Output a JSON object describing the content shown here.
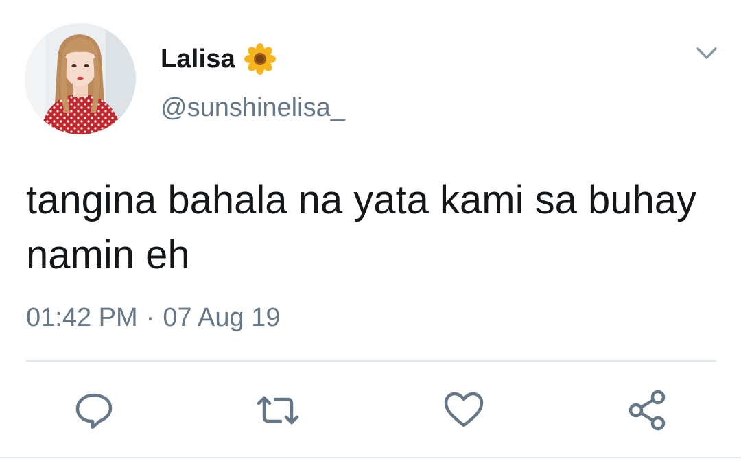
{
  "tweet": {
    "display_name": "Lalisa",
    "name_emoji": "sunflower-icon",
    "handle": "@sunshinelisa_",
    "text": "tangina bahala na yata kami sa buhay namin eh",
    "time": "01:42 PM",
    "separator": "·",
    "date": "07 Aug 19"
  },
  "icons": {
    "menu": "chevron-down-icon",
    "reply": "reply-icon",
    "retweet": "retweet-icon",
    "like": "heart-icon",
    "share": "share-icon"
  },
  "colors": {
    "text": "#14171a",
    "secondary": "#657786",
    "divider": "#e1e8ed",
    "background": "#ffffff"
  }
}
